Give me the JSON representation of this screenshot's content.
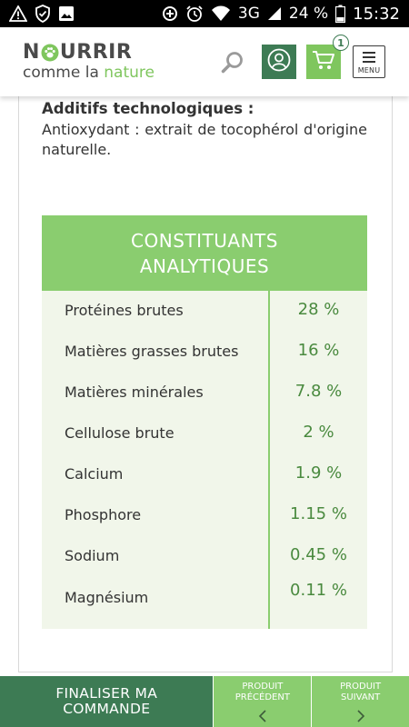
{
  "status_bar": {
    "network": "3G",
    "battery": "24 %",
    "time": "15:32"
  },
  "header": {
    "logo_line1": "NOURRIR",
    "logo_line2_prefix": "comme la ",
    "logo_line2_accent": "nature",
    "cart_count": "1",
    "menu_label": "MENU",
    "brand_dark": "#3d7b54",
    "brand_light": "#7fc65e"
  },
  "additifs": {
    "title": "Additifs technologiques :",
    "text": "Antioxydant : extrait de tocophérol d'origine naturelle."
  },
  "table": {
    "title_line1": "CONSTITUANTS",
    "title_line2": "ANALYTIQUES",
    "rows": [
      {
        "label": "Protéines brutes",
        "value": "28 %"
      },
      {
        "label": "Matières grasses brutes",
        "value": "16 %"
      },
      {
        "label": "Matières minérales",
        "value": "7.8 %"
      },
      {
        "label": "Cellulose brute",
        "value": "2 %"
      },
      {
        "label": "Calcium",
        "value": "1.9 %"
      },
      {
        "label": "Phosphore",
        "value": "1.15 %"
      },
      {
        "label": "Sodium",
        "value": "0.45 %"
      },
      {
        "label": "Magnésium",
        "value": "0.11 %"
      }
    ]
  },
  "bottom_bar": {
    "finalize_line1": "FINALISER MA",
    "finalize_line2": "COMMANDE",
    "prev_line1": "PRODUIT",
    "prev_line2": "PRÉCÉDENT",
    "next_line1": "PRODUIT",
    "next_line2": "SUIVANT"
  }
}
